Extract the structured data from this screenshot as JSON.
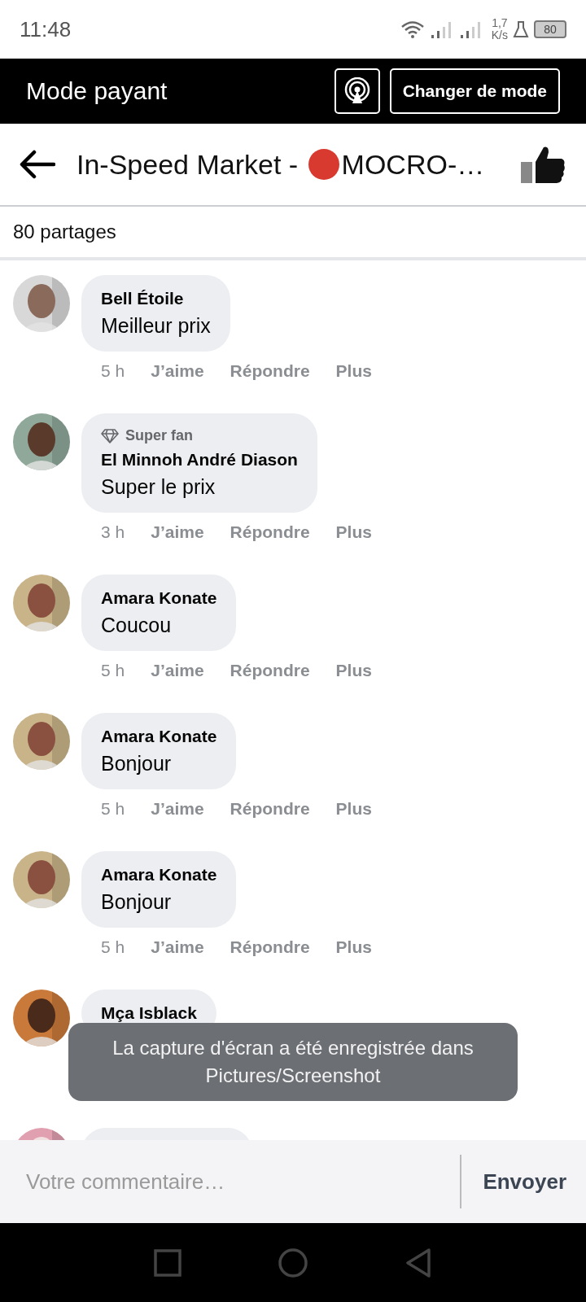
{
  "status_bar": {
    "time": "11:48",
    "speed_value": "1,7",
    "speed_unit": "K/s",
    "battery": "80"
  },
  "mode_bar": {
    "title": "Mode payant",
    "button": "Changer de mode"
  },
  "header": {
    "title_prefix": "In-Speed Market -",
    "title_suffix": "MOCRO-…"
  },
  "shares": "80 partages",
  "comments": [
    {
      "author": "Bell Étoile",
      "text": "Meilleur prix",
      "time": "5 h",
      "actions": [
        "J’aime",
        "Répondre",
        "Plus"
      ]
    },
    {
      "badge": "Super fan",
      "author": "El Minnoh André Diason",
      "text": "Super le prix",
      "time": "3 h",
      "actions": [
        "J’aime",
        "Répondre",
        "Plus"
      ]
    },
    {
      "author": "Amara Konate",
      "text": "Coucou",
      "time": "5 h",
      "actions": [
        "J’aime",
        "Répondre",
        "Plus"
      ]
    },
    {
      "author": "Amara Konate",
      "text": "Bonjour",
      "time": "5 h",
      "actions": [
        "J’aime",
        "Répondre",
        "Plus"
      ]
    },
    {
      "author": "Amara Konate",
      "text": "Bonjour",
      "time": "5 h",
      "actions": [
        "J’aime",
        "Répondre",
        "Plus"
      ]
    },
    {
      "author": "Mça Isblack"
    },
    {
      "kind": "cut"
    }
  ],
  "toast": "La capture d'écran a été enregistrée dans Pictures/Screenshot",
  "composer": {
    "placeholder": "Votre commentaire…",
    "send": "Envoyer"
  }
}
